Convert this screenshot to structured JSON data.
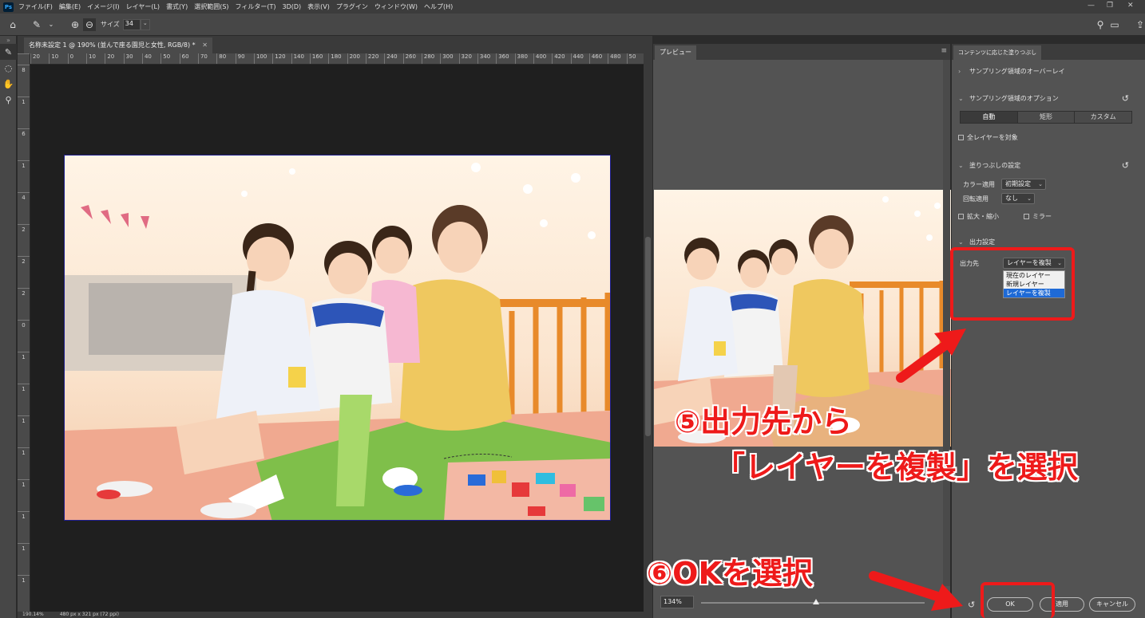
{
  "app": {
    "logo": "Ps"
  },
  "menu": [
    "ファイル(F)",
    "編集(E)",
    "イメージ(I)",
    "レイヤー(L)",
    "書式(Y)",
    "選択範囲(S)",
    "フィルター(T)",
    "3D(D)",
    "表示(V)",
    "プラグイン",
    "ウィンドウ(W)",
    "ヘルプ(H)"
  ],
  "options_bar": {
    "size_label": "サイズ",
    "size_value": "34"
  },
  "document": {
    "tab_title": "名称未設定 1 @ 190% (並んで座る園児と女性, RGB/8) *",
    "ruler_ticks": [
      "20",
      "10",
      "0",
      "10",
      "20",
      "30",
      "40",
      "50",
      "60",
      "70",
      "80",
      "90",
      "100",
      "120",
      "140",
      "160",
      "180",
      "200",
      "220",
      "240",
      "260",
      "280",
      "300",
      "320",
      "340",
      "360",
      "380",
      "400",
      "420",
      "440",
      "460",
      "480",
      "50"
    ],
    "ruler_v_ticks": [
      "8",
      "1",
      "6",
      "1",
      "4",
      "2",
      "2",
      "2",
      "0",
      "1",
      "1",
      "1",
      "1",
      "1",
      "1",
      "1",
      "1"
    ],
    "status_zoom": "190.14%",
    "status_size": "480 px x 321 px (72 ppi)"
  },
  "preview": {
    "tab": "プレビュー",
    "zoom": "134%"
  },
  "fill_panel": {
    "tab": "コンテンツに応じた塗りつぶし",
    "overlay_section": "サンプリング領域のオーバーレイ",
    "options_section": "サンプリング領域のオプション",
    "sampling_modes": [
      "自動",
      "矩形",
      "カスタム"
    ],
    "all_layers": "全レイヤーを対象",
    "fill_settings": "塗りつぶしの設定",
    "color_adapt_label": "カラー適用",
    "color_adapt_value": "初期設定",
    "rotation_label": "回転適用",
    "rotation_value": "なし",
    "scale_label": "拡大・縮小",
    "mirror_label": "ミラー",
    "output_section": "出力設定",
    "output_label": "出力先",
    "output_value": "レイヤーを複製",
    "output_options": [
      "現在のレイヤー",
      "新規レイヤー",
      "レイヤーを複製"
    ],
    "ok": "OK",
    "apply": "適用",
    "cancel": "キャンセル"
  },
  "annotations": {
    "step5_line1": "⑤出力先から",
    "step5_line2": "「レイヤーを複製」を選択",
    "step6": "⑥OKを選択"
  },
  "colors": {
    "accent_red": "#ee1a1a",
    "highlight_blue": "#1e6ad6"
  }
}
